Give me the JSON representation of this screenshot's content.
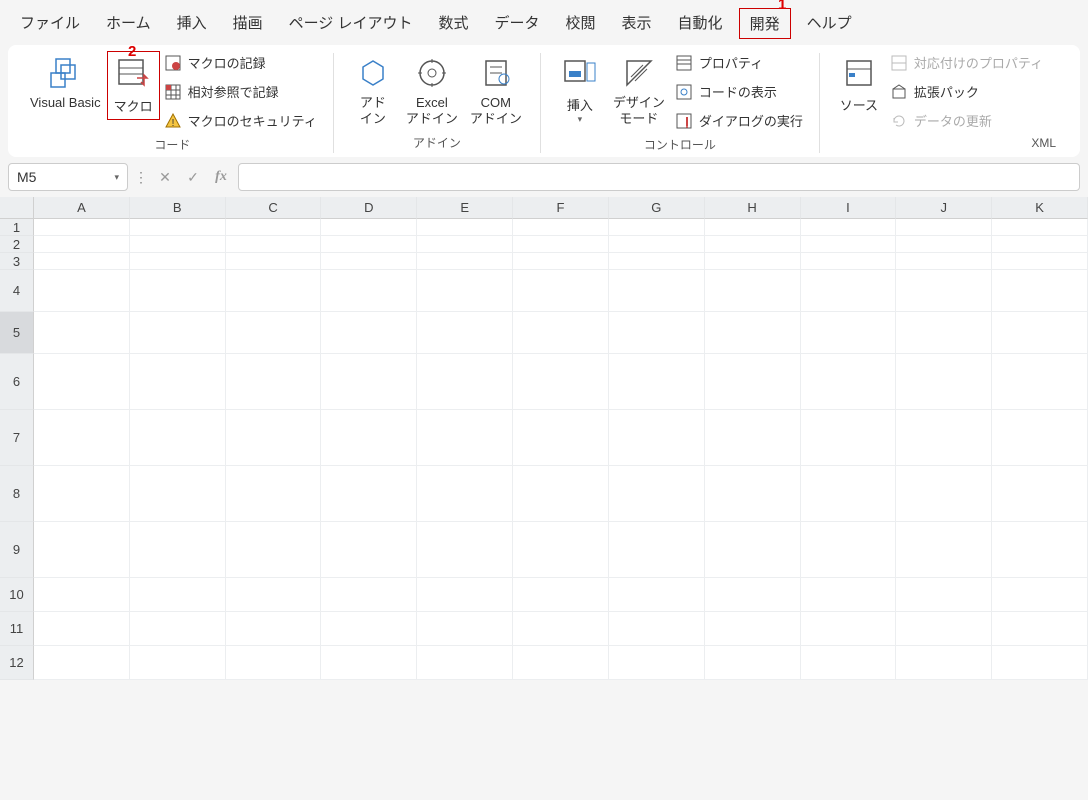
{
  "menu": {
    "items": [
      "ファイル",
      "ホーム",
      "挿入",
      "描画",
      "ページ レイアウト",
      "数式",
      "データ",
      "校閲",
      "表示",
      "自動化",
      "開発",
      "ヘルプ"
    ],
    "active_index": 10
  },
  "annotations": {
    "a1": "1",
    "a2": "2"
  },
  "ribbon": {
    "code": {
      "label": "コード",
      "visual_basic": "Visual Basic",
      "macros": "マクロ",
      "record_macro": "マクロの記録",
      "relative_ref": "相対参照で記録",
      "macro_security": "マクロのセキュリティ"
    },
    "addins": {
      "label": "アドイン",
      "addin": "アド\nイン",
      "excel_addin": "Excel\nアドイン",
      "com_addin": "COM\nアドイン"
    },
    "controls": {
      "label": "コントロール",
      "insert": "挿入",
      "design_mode": "デザイン\nモード",
      "properties": "プロパティ",
      "view_code": "コードの表示",
      "run_dialog": "ダイアログの実行"
    },
    "xml": {
      "label": "XML",
      "source": "ソース",
      "map_properties": "対応付けのプロパティ",
      "expansion_packs": "拡張パック",
      "refresh_data": "データの更新"
    }
  },
  "formula_bar": {
    "name_box": "M5",
    "value": ""
  },
  "grid": {
    "columns": [
      "A",
      "B",
      "C",
      "D",
      "E",
      "F",
      "G",
      "H",
      "I",
      "J",
      "K"
    ],
    "rows": [
      "1",
      "2",
      "3",
      "4",
      "5",
      "6",
      "7",
      "8",
      "9",
      "10",
      "11",
      "12"
    ],
    "selected_row_index": 4
  }
}
